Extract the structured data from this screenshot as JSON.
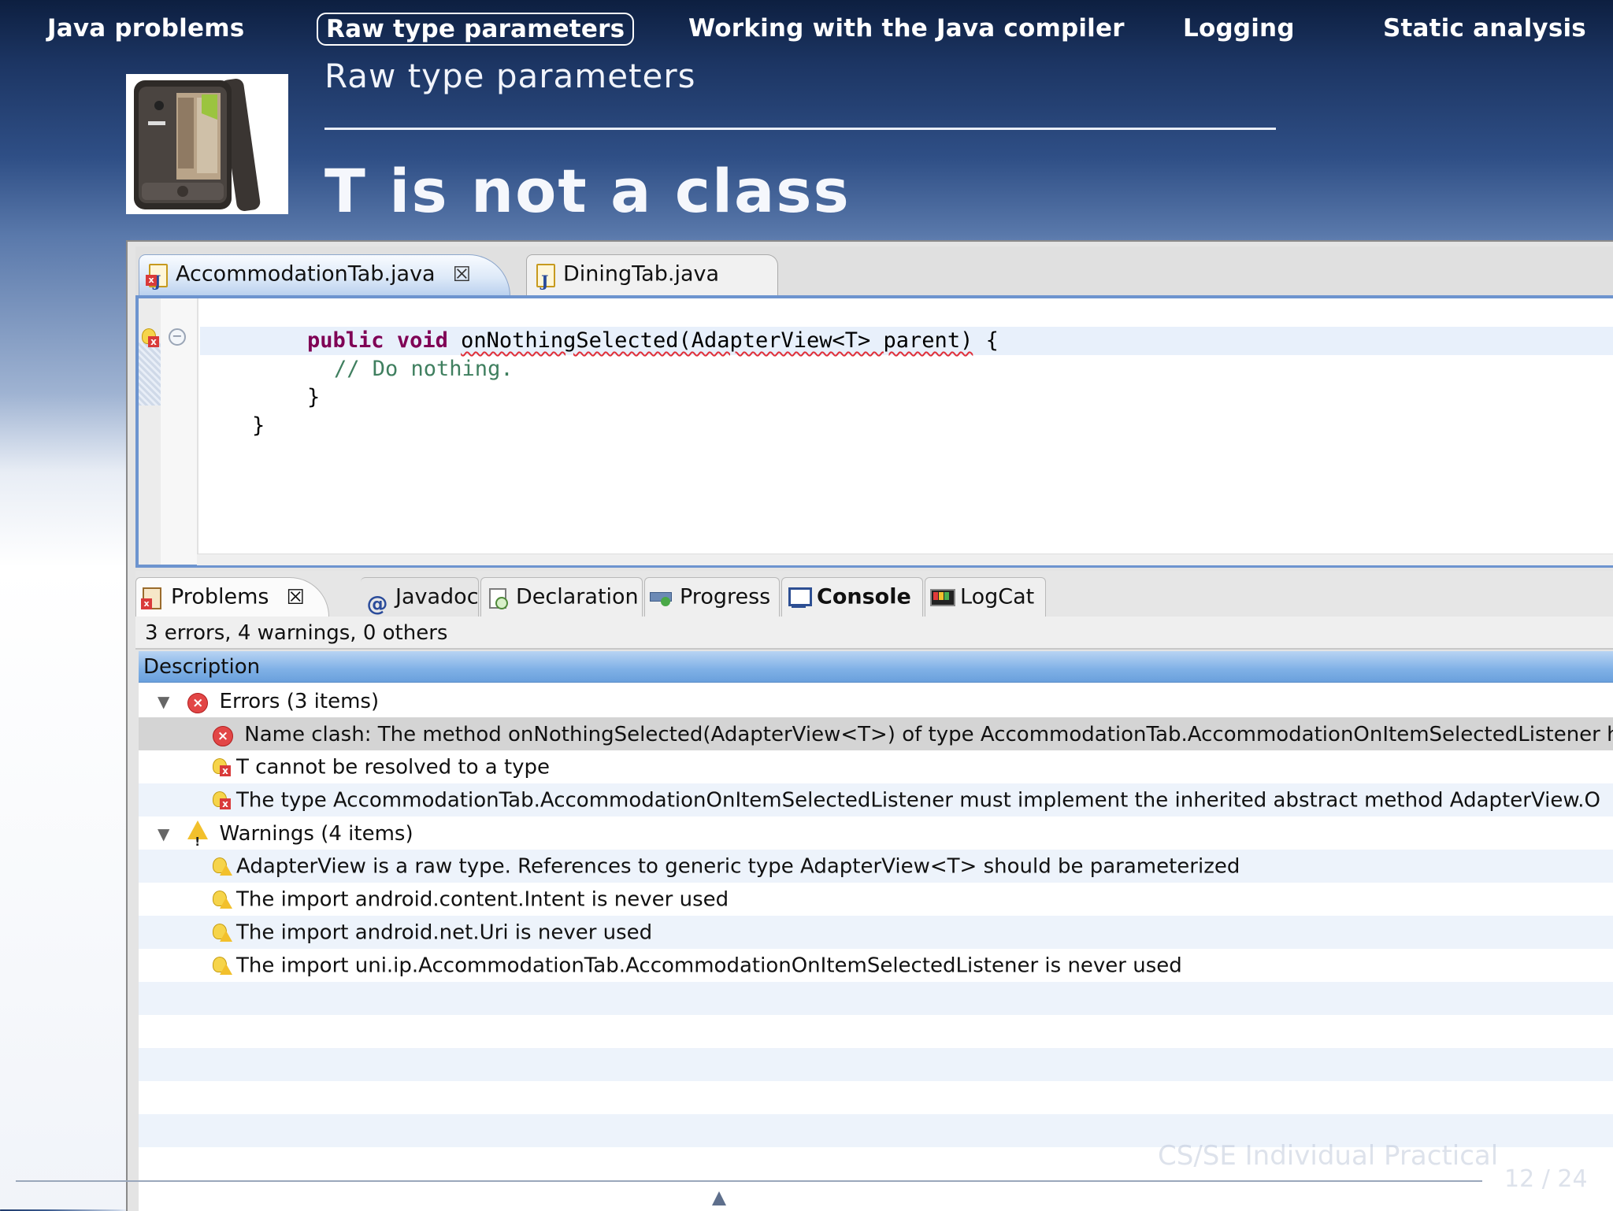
{
  "nav": {
    "items": [
      "Java problems",
      "Raw type parameters",
      "Working with the Java compiler",
      "Logging",
      "Static analysis"
    ],
    "active_index": 1
  },
  "slide": {
    "subtitle": "Raw type parameters",
    "title": "T is not a class"
  },
  "editor": {
    "tabs": [
      {
        "label": "AccommodationTab.java",
        "close_glyph": "☒",
        "active": true
      },
      {
        "label": "DiningTab.java",
        "active": false
      }
    ],
    "code": {
      "line1_kw1": "public",
      "line1_kw2": "void",
      "line1_method": "onNothingSelected(AdapterView<T> parent)",
      "line1_tail": " {",
      "line2": "// Do nothing.",
      "line3": "}",
      "line4": "}"
    }
  },
  "views": {
    "tabs": [
      {
        "label": "Problems",
        "close_glyph": "☒"
      },
      {
        "label": "Javadoc",
        "icon_glyph": "@"
      },
      {
        "label": "Declaration"
      },
      {
        "label": "Progress"
      },
      {
        "label": "Console"
      },
      {
        "label": "LogCat"
      }
    ],
    "summary": "3 errors, 4 warnings, 0 others",
    "column_header": "Description",
    "groups": {
      "errors_label": "Errors (3 items)",
      "warnings_label": "Warnings (4 items)"
    },
    "errors": [
      "Name clash: The method onNothingSelected(AdapterView<T>) of type AccommodationTab.AccommodationOnItemSelectedListener h",
      "T cannot be resolved to a type",
      "The type AccommodationTab.AccommodationOnItemSelectedListener must implement the inherited abstract method AdapterView.O"
    ],
    "warnings": [
      "AdapterView is a raw type. References to generic type AdapterView<T> should be parameterized",
      "The import android.content.Intent is never used",
      "The import android.net.Uri is never used",
      "The import uni.ip.AccommodationTab.AccommodationOnItemSelectedListener is never used"
    ]
  },
  "footer": {
    "course": "CS/SE Individual Practical",
    "page": "12 / 24"
  },
  "colors": {
    "header_navy": "#1c3563",
    "editor_border": "#6d94cf",
    "keyword": "#7f0055",
    "comment": "#3f7f5f",
    "error_red": "#e24646",
    "warning_yellow": "#f2c02c",
    "column_header_blue": "#7fb0e6"
  },
  "icons": {
    "editor_tab_active": "java-file-error-icon",
    "editor_tab_inactive": "java-file-icon",
    "problems": "problems-icon",
    "javadoc": "javadoc-icon",
    "declaration": "declaration-icon",
    "progress": "progress-icon",
    "console": "console-icon",
    "logcat": "logcat-icon"
  }
}
